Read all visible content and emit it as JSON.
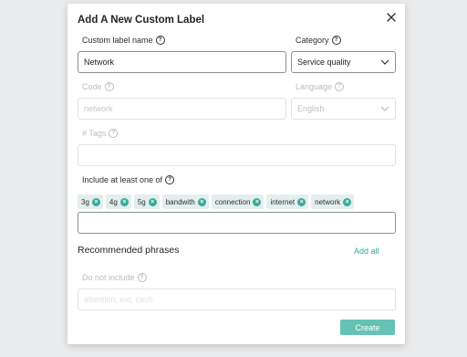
{
  "dialog": {
    "title": "Add A New Custom Label",
    "close_icon": "close-icon"
  },
  "fields": {
    "custom_label_name": {
      "label": "Custom label name",
      "value": "Network"
    },
    "category": {
      "label": "Category",
      "value": "Service quality"
    },
    "code": {
      "label": "Code",
      "placeholder": "network"
    },
    "language": {
      "label": "Language",
      "value": "English"
    },
    "tags": {
      "label": "# Tags",
      "value": ""
    },
    "include": {
      "label": "Include at least one of",
      "chips": [
        "3g",
        "4g",
        "5g",
        "bandwith",
        "connection",
        "internet",
        "network"
      ],
      "value": ""
    },
    "do_not_include": {
      "label": "Do not include",
      "placeholder": "attention, ext, cash"
    }
  },
  "recommended": {
    "title": "Recommended phrases",
    "add_all": "Add all"
  },
  "actions": {
    "create": "Create"
  },
  "colors": {
    "accent": "#36aa9a",
    "button": "#66c2b5",
    "chip_bg": "#e4efed"
  }
}
